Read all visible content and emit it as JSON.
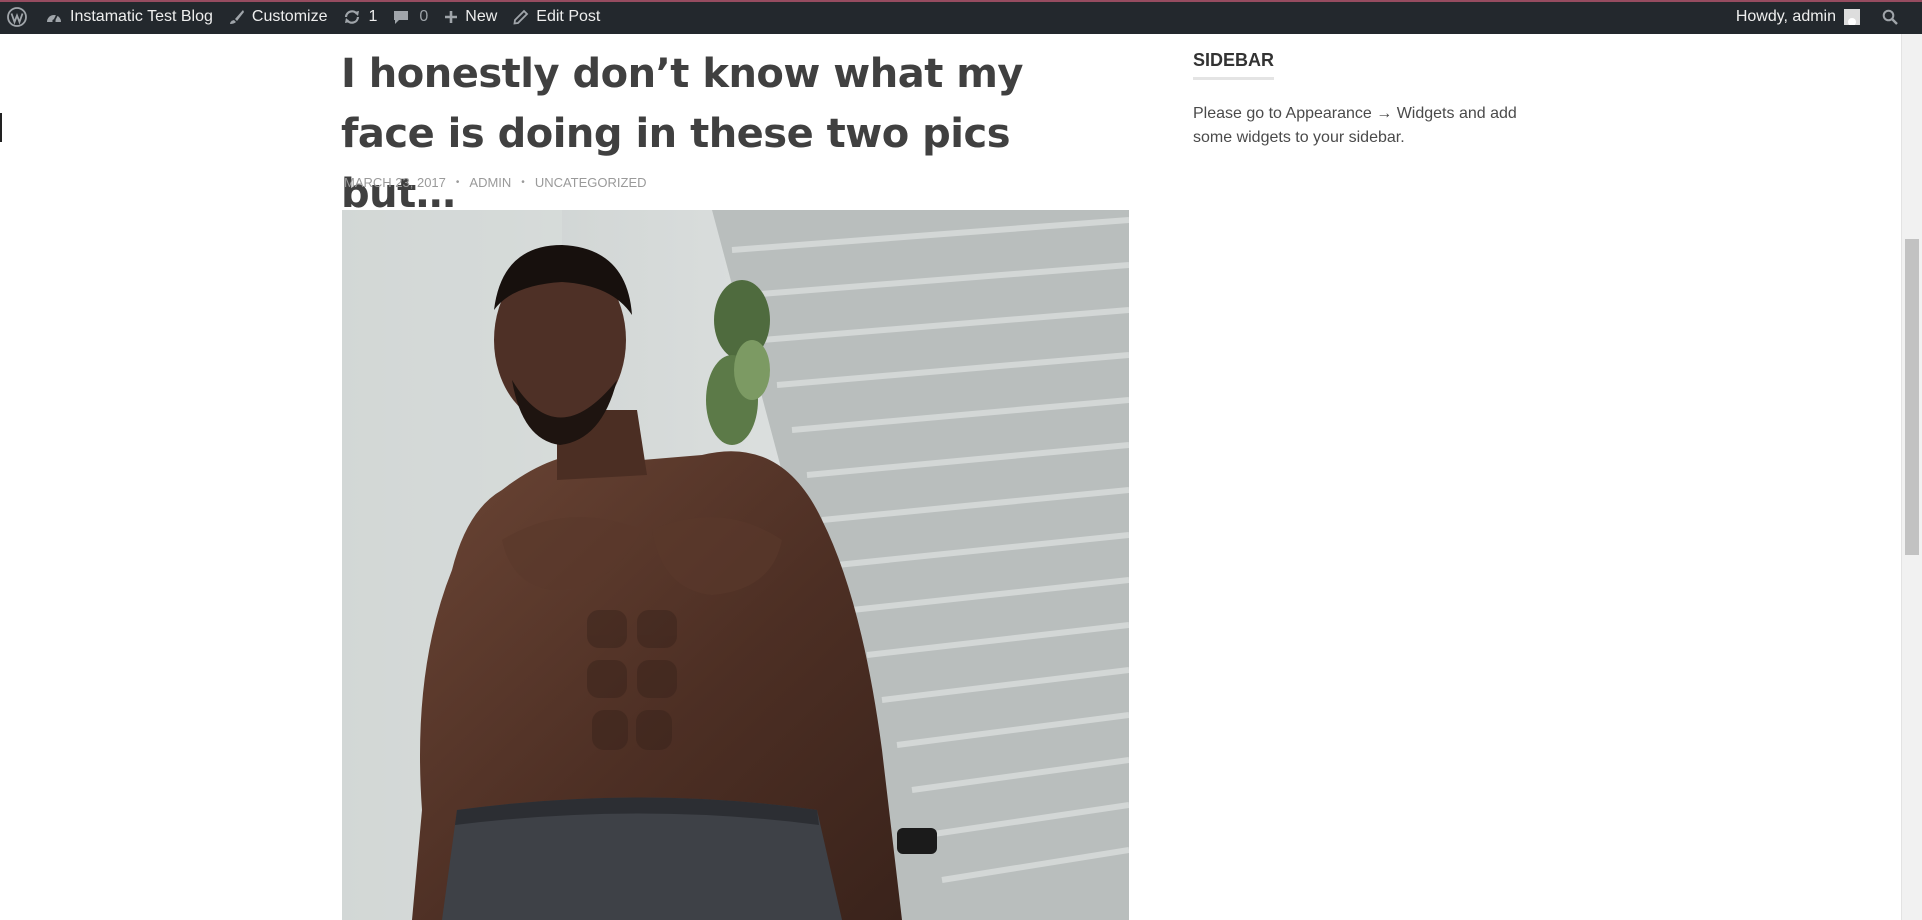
{
  "adminbar": {
    "site_name": "Instamatic Test Blog",
    "customize": "Customize",
    "updates_count": "1",
    "comments_count": "0",
    "new_label": "New",
    "edit_post": "Edit Post",
    "greeting": "Howdy, admin",
    "colors": {
      "bar": "#23282d",
      "text": "#eeeeee",
      "muted": "#9ca2a7"
    }
  },
  "post": {
    "title": "I honestly don’t know what my face is doing in these two pics but…",
    "meta": {
      "date": "March 23, 2017",
      "author": "Admin",
      "category": "Uncategorized",
      "separator": "•"
    },
    "featured_image_alt": ""
  },
  "sidebar": {
    "title": "SIDEBAR",
    "text": "Please go to Appearance → Widgets and add some widgets to your sidebar."
  },
  "icons": [
    "wordpress-icon",
    "dashboard-icon",
    "brush-icon",
    "updates-icon",
    "comment-icon",
    "plus-icon",
    "pencil-icon",
    "search-icon",
    "user-icon"
  ]
}
